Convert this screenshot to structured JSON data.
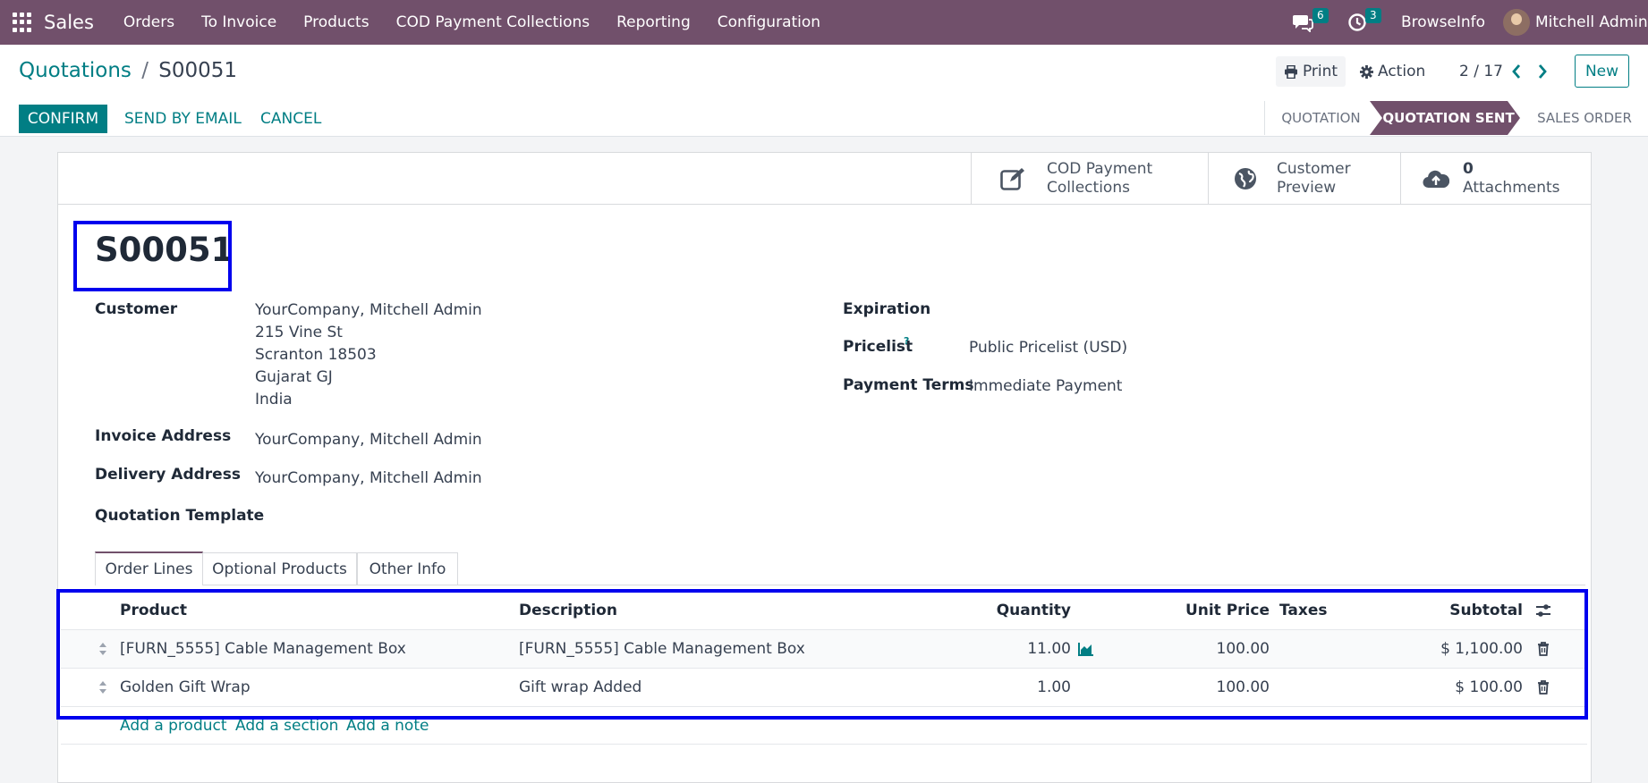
{
  "nav": {
    "app": "Sales",
    "menu": [
      "Orders",
      "To Invoice",
      "Products",
      "COD Payment Collections",
      "Reporting",
      "Configuration"
    ],
    "chat_count": "6",
    "activity_count": "3",
    "company": "BrowseInfo",
    "user": "Mitchell Admin"
  },
  "breadcrumb": {
    "parent": "Quotations",
    "sep": "/",
    "current": "S00051"
  },
  "toolbar": {
    "print": "Print",
    "action": "Action",
    "pager": "2 / 17",
    "new": "New"
  },
  "buttons": {
    "confirm": "CONFIRM",
    "send": "SEND BY EMAIL",
    "cancel": "CANCEL"
  },
  "statusbar": {
    "s1": "QUOTATION",
    "s2": "QUOTATION SENT",
    "s3": "SALES ORDER",
    "active": "QUOTATION SENT"
  },
  "smart_buttons": {
    "cod_l1": "COD Payment",
    "cod_l2": "Collections",
    "preview_l1": "Customer",
    "preview_l2": "Preview",
    "attach_count": "0",
    "attach_label": "Attachments"
  },
  "record": {
    "name": "S00051",
    "customer_label": "Customer",
    "customer": "YourCompany, Mitchell Admin",
    "addr1": "215 Vine St",
    "addr2": "Scranton 18503",
    "addr3": "Gujarat GJ",
    "addr4": "India",
    "invoice_label": "Invoice Address",
    "invoice": "YourCompany, Mitchell Admin",
    "delivery_label": "Delivery Address",
    "delivery": "YourCompany, Mitchell Admin",
    "template_label": "Quotation Template",
    "expiration_label": "Expiration",
    "pricelist_label": "Pricelist",
    "pricelist_help": "?",
    "pricelist": "Public Pricelist (USD)",
    "terms_label": "Payment Terms",
    "terms": "Immediate Payment"
  },
  "tabs": {
    "t1": "Order Lines",
    "t2": "Optional Products",
    "t3": "Other Info",
    "active": "Order Lines"
  },
  "table": {
    "headers": {
      "product": "Product",
      "description": "Description",
      "quantity": "Quantity",
      "unit_price": "Unit Price",
      "taxes": "Taxes",
      "subtotal": "Subtotal"
    },
    "rows": [
      {
        "product": "[FURN_5555] Cable Management Box",
        "description": "[FURN_5555] Cable Management Box",
        "quantity": "11.00",
        "unit_price": "100.00",
        "taxes": "",
        "subtotal": "$ 1,100.00"
      },
      {
        "product": "Golden Gift Wrap",
        "description": "Gift wrap Added",
        "quantity": "1.00",
        "unit_price": "100.00",
        "taxes": "",
        "subtotal": "$ 100.00"
      }
    ],
    "add_product": "Add a product",
    "add_section": "Add a section",
    "add_note": "Add a note"
  },
  "colors": {
    "primary": "#017e84",
    "navbar": "#71506b",
    "highlight": "#0000ee"
  }
}
